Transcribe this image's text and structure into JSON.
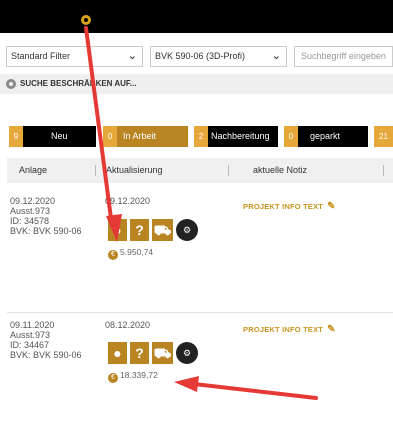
{
  "filters": {
    "filter_select": "Standard Filter",
    "project_select": "BVK 590-06 (3D-Profi)",
    "search_placeholder": "Suchbegriff eingeben"
  },
  "restrict_label": "SUCHE BESCHRÄNKEN AUF...",
  "tabs": [
    {
      "count": "9",
      "label": "Neu",
      "color": "#000000"
    },
    {
      "count": "0",
      "label": "In Arbeit",
      "color": "#b98422"
    },
    {
      "count": "2",
      "label": "Nachbereitung",
      "color": "#000000"
    },
    {
      "count": "0",
      "label": "geparkt",
      "color": "#000000"
    },
    {
      "count": "21",
      "label": "",
      "color": "#000000"
    }
  ],
  "table": {
    "headers": [
      "Anlage",
      "Aktualisierung",
      "aktuelle Notiz"
    ],
    "rows": [
      {
        "anlage": [
          "09.12.2020",
          "Ausst.973",
          "ID: 34578",
          "BVK: BVK 590-06"
        ],
        "aktualisierung": "09.12.2020",
        "notiz": "PROJEKT INFO TEXT",
        "price": "5.950,74"
      },
      {
        "anlage": [
          "09.11.2020",
          "Ausst.973",
          "ID: 34467",
          "BVK: BVK 590-06"
        ],
        "aktualisierung": "08.12.2020",
        "notiz": "PROJEKT INFO TEXT",
        "price": "18.339,72"
      }
    ]
  },
  "colors": {
    "accent": "#b98422",
    "arrow": "#e53935",
    "topbar": "#000000"
  }
}
